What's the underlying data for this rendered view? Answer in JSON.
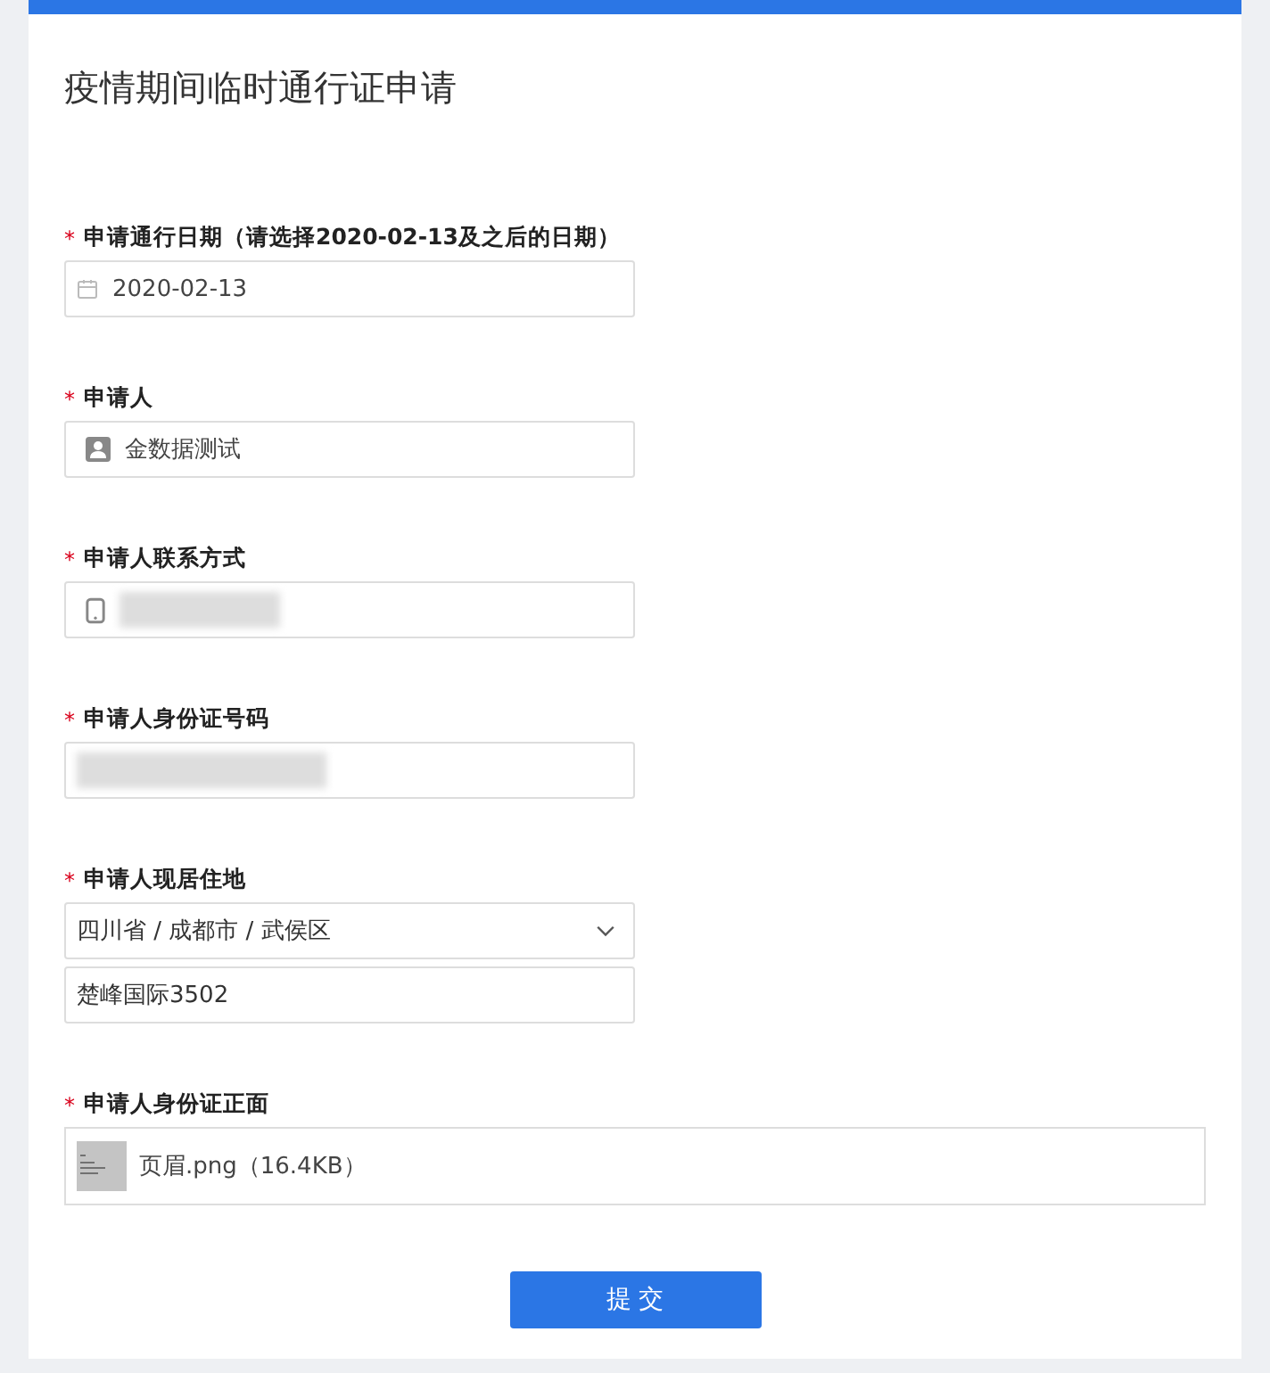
{
  "title": "疫情期间临时通行证申请",
  "fields": [
    {
      "kind": "date",
      "required_mark": "*",
      "label": "申请通行日期（请选择**2020-02-13**及之后的日期）",
      "value": "2020-02-13"
    },
    {
      "kind": "person",
      "required_mark": "*",
      "label": "申请人",
      "value": "金数据测试"
    },
    {
      "kind": "phone",
      "required_mark": "*",
      "label": "申请人联系方式",
      "redacted": true
    },
    {
      "kind": "text",
      "required_mark": "*",
      "label": "申请人身份证号码",
      "redacted": true
    },
    {
      "kind": "address",
      "required_mark": "*",
      "label": "申请人现居住地",
      "value": "四川省 / 成都市 / 武侯区",
      "detail": "楚峰国际3502"
    },
    {
      "kind": "upload",
      "required_mark": "*",
      "label": "申请人身份证正面",
      "value": "页眉.png（16.4KB）"
    }
  ],
  "submit": "提 交"
}
